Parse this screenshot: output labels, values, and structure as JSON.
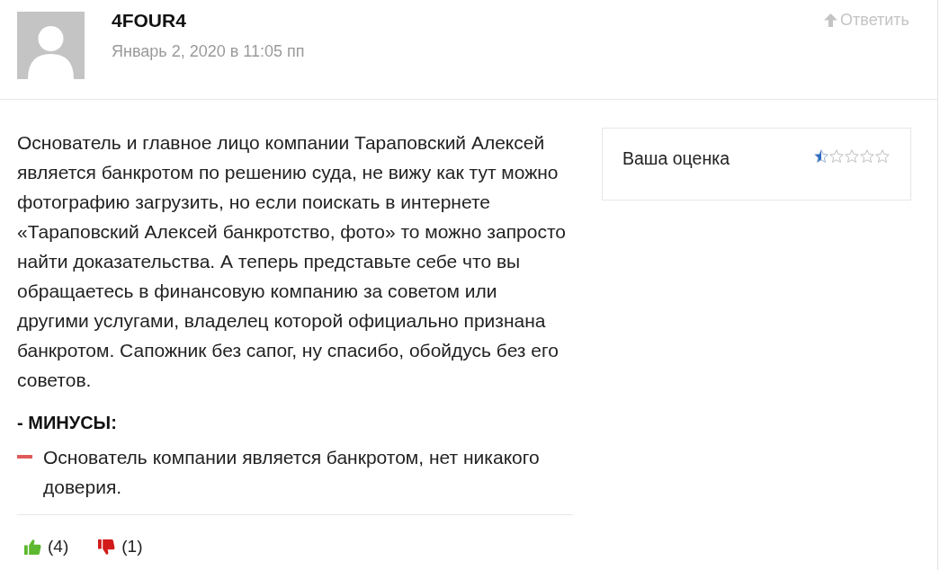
{
  "comment": {
    "author": "4FOUR4",
    "date": "Январь 2, 2020 в 11:05 пп",
    "reply_link": "Ответить",
    "text": "Основатель и главное лицо компании Тараповский Алексей является банкротом по решению суда, не вижу как тут можно фотографию загрузить, но если поискать в интернете «Тараповский Алексей банкротство, фото» то можно запросто найти доказательства. А теперь представьте себе что вы обращаетесь в финансовую компанию за советом или другими услугами, владелец которой официально признана банкротом. Сапожник без сапог, ну спасибо, обойдусь без его советов.",
    "rating": {
      "label": "Ваша оценка",
      "stars": 0.5
    },
    "cons": {
      "heading": "- МИНУСЫ:",
      "items": [
        "Основатель компании является банкротом, нет никакого доверия."
      ]
    },
    "votes": [
      {
        "kind": "up",
        "count": "(4)"
      },
      {
        "kind": "down",
        "count": "(1)"
      }
    ]
  }
}
